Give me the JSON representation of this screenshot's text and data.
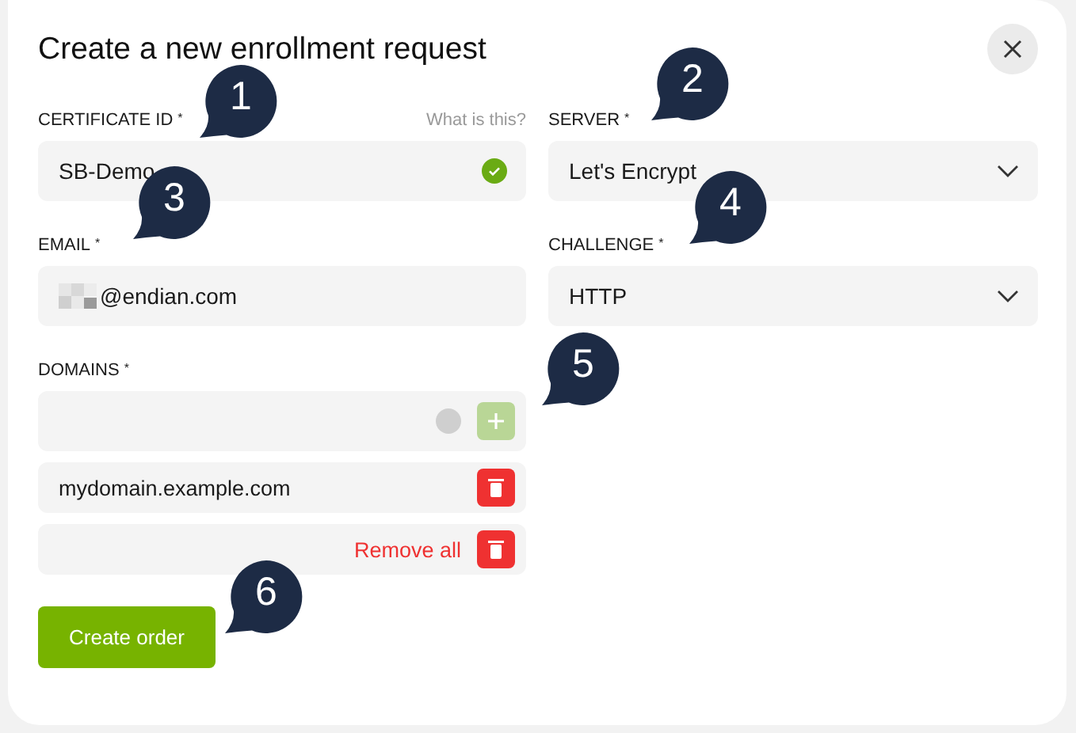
{
  "dialog": {
    "title": "Create a new enrollment request"
  },
  "certificate_id": {
    "label": "CERTIFICATE ID",
    "required_mark": "*",
    "help_link": "What is this?",
    "value": "SB-Demo",
    "valid": true
  },
  "server": {
    "label": "SERVER",
    "required_mark": "*",
    "value": "Let's Encrypt"
  },
  "email": {
    "label": "EMAIL",
    "required_mark": "*",
    "value": "@endian.com",
    "redacted": true
  },
  "challenge": {
    "label": "CHALLENGE",
    "required_mark": "*",
    "value": "HTTP"
  },
  "domains": {
    "label": "DOMAINS",
    "required_mark": "*",
    "new_entry": {
      "valid": false,
      "add_enabled": false
    },
    "entries": [
      {
        "value": "mydomain.example.com"
      }
    ],
    "remove_all": "Remove all"
  },
  "submit": "Create order",
  "callouts": [
    {
      "number": "1"
    },
    {
      "number": "2"
    },
    {
      "number": "3"
    },
    {
      "number": "4"
    },
    {
      "number": "5"
    },
    {
      "number": "6"
    }
  ]
}
